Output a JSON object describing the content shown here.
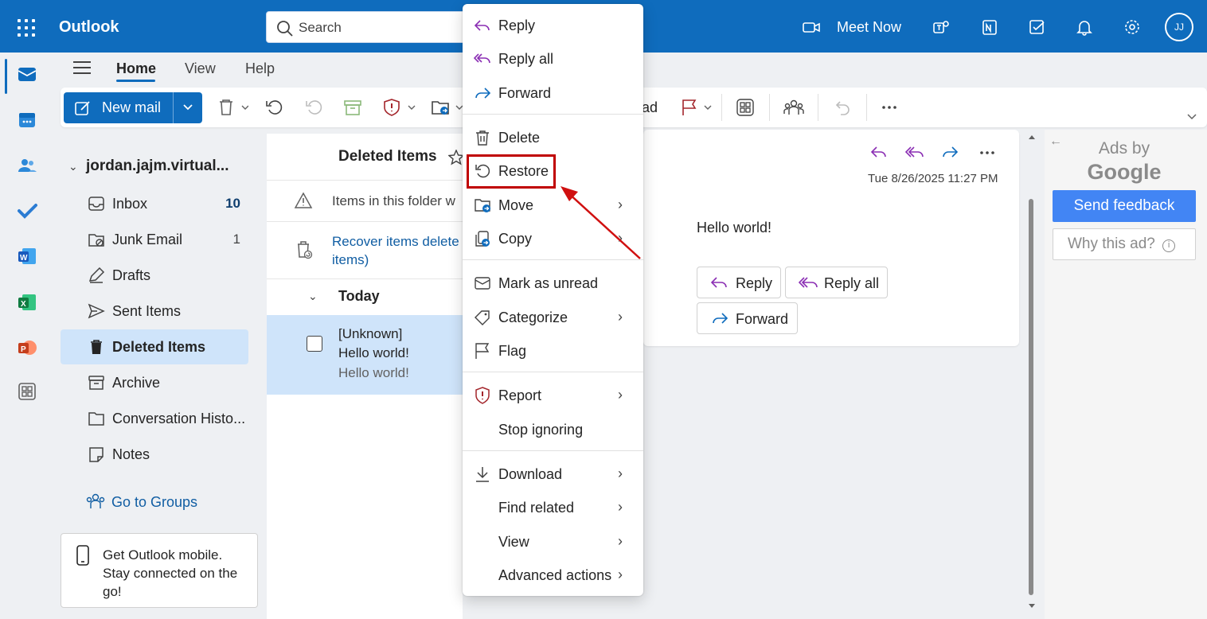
{
  "app": {
    "title": "Outlook"
  },
  "search": {
    "placeholder": "Search"
  },
  "header": {
    "meet_now": "Meet Now",
    "avatar_initials": "JJ"
  },
  "ribbon": {
    "tabs": [
      "Home",
      "View",
      "Help"
    ],
    "active_tab": "Home",
    "new_mail": "New mail",
    "read_partial": "ad"
  },
  "folders": {
    "account": "jordan.jajm.virtual...",
    "items": [
      {
        "label": "Inbox",
        "count": "10",
        "icon": "inbox-icon"
      },
      {
        "label": "Junk Email",
        "count": "1",
        "icon": "junk-icon"
      },
      {
        "label": "Drafts",
        "count": "",
        "icon": "drafts-icon"
      },
      {
        "label": "Sent Items",
        "count": "",
        "icon": "sent-icon"
      },
      {
        "label": "Deleted Items",
        "count": "",
        "icon": "trash-icon",
        "selected": true
      },
      {
        "label": "Archive",
        "count": "",
        "icon": "archive-icon"
      },
      {
        "label": "Conversation Histo...",
        "count": "",
        "icon": "folder-icon"
      },
      {
        "label": "Notes",
        "count": "",
        "icon": "notes-icon"
      }
    ],
    "go_to_groups": "Go to Groups"
  },
  "mobile_promo": {
    "text": "Get Outlook mobile. Stay connected on the go!"
  },
  "message_list": {
    "title": "Deleted Items",
    "notice": "Items in this folder w",
    "recover_line1": "Recover items delete",
    "recover_line2": "items)",
    "group": "Today",
    "message": {
      "sender": "[Unknown]",
      "subject": "Hello world!",
      "preview": "Hello world!"
    }
  },
  "reading_pane": {
    "date": "Tue 8/26/2025 11:27 PM",
    "body": "Hello world!",
    "reply": "Reply",
    "reply_all": "Reply all",
    "forward": "Forward"
  },
  "ads": {
    "ads_by": "Ads by",
    "google": "Google",
    "send_feedback": "Send feedback",
    "why_this_ad": "Why this ad?"
  },
  "context_menu": {
    "items": [
      {
        "label": "Reply",
        "icon": "reply-icon"
      },
      {
        "label": "Reply all",
        "icon": "reply-all-icon"
      },
      {
        "label": "Forward",
        "icon": "forward-icon"
      },
      {
        "label": "Delete",
        "icon": "delete-icon"
      },
      {
        "label": "Restore",
        "icon": "restore-icon",
        "highlighted": true
      },
      {
        "label": "Move",
        "icon": "move-icon",
        "submenu": true
      },
      {
        "label": "Copy",
        "icon": "copy-icon",
        "submenu": true
      },
      {
        "label": "Mark as unread",
        "icon": "mail-icon"
      },
      {
        "label": "Categorize",
        "icon": "tag-icon",
        "submenu": true
      },
      {
        "label": "Flag",
        "icon": "flag-icon"
      },
      {
        "label": "Report",
        "icon": "report-icon",
        "submenu": true
      },
      {
        "label": "Stop ignoring",
        "icon": ""
      },
      {
        "label": "Download",
        "icon": "download-icon",
        "submenu": true
      },
      {
        "label": "Find related",
        "icon": "",
        "submenu": true
      },
      {
        "label": "View",
        "icon": "",
        "submenu": true
      },
      {
        "label": "Advanced actions",
        "icon": "",
        "submenu": true
      }
    ]
  },
  "colors": {
    "brand": "#0f6cbd",
    "selected": "#cfe4fa",
    "highlight": "#c00000",
    "ad_button": "#4285f4"
  }
}
